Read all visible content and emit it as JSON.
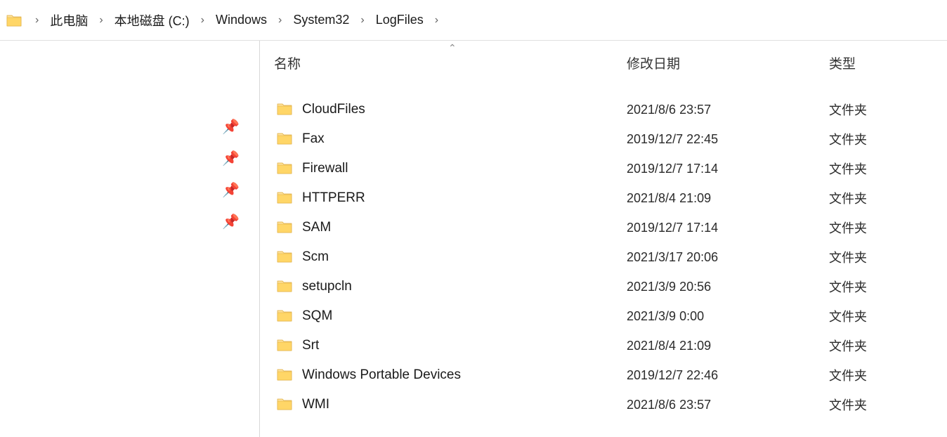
{
  "breadcrumb": {
    "items": [
      {
        "label": "此电脑"
      },
      {
        "label": "本地磁盘 (C:)"
      },
      {
        "label": "Windows"
      },
      {
        "label": "System32"
      },
      {
        "label": "LogFiles"
      }
    ]
  },
  "columns": {
    "name": "名称",
    "date": "修改日期",
    "type": "类型"
  },
  "items": [
    {
      "name": "CloudFiles",
      "date": "2021/8/6 23:57",
      "type": "文件夹"
    },
    {
      "name": "Fax",
      "date": "2019/12/7 22:45",
      "type": "文件夹"
    },
    {
      "name": "Firewall",
      "date": "2019/12/7 17:14",
      "type": "文件夹"
    },
    {
      "name": "HTTPERR",
      "date": "2021/8/4 21:09",
      "type": "文件夹"
    },
    {
      "name": "SAM",
      "date": "2019/12/7 17:14",
      "type": "文件夹"
    },
    {
      "name": "Scm",
      "date": "2021/3/17 20:06",
      "type": "文件夹"
    },
    {
      "name": "setupcln",
      "date": "2021/3/9 20:56",
      "type": "文件夹"
    },
    {
      "name": "SQM",
      "date": "2021/3/9 0:00",
      "type": "文件夹"
    },
    {
      "name": "Srt",
      "date": "2021/8/4 21:09",
      "type": "文件夹"
    },
    {
      "name": "Windows Portable Devices",
      "date": "2019/12/7 22:46",
      "type": "文件夹"
    },
    {
      "name": "WMI",
      "date": "2021/8/6 23:57",
      "type": "文件夹"
    }
  ],
  "quickaccess_pins": 4
}
